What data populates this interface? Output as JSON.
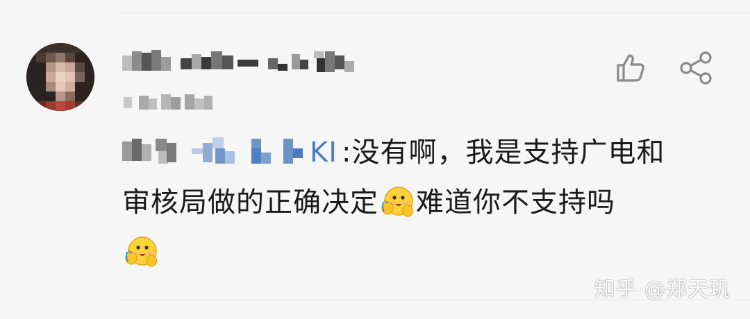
{
  "comment": {
    "author": "",
    "time": "",
    "mention_tail": "KI",
    "text_part1": ":没有啊，我是支持广电和",
    "text_part2": "审核局做的正确决定",
    "text_part3": "难道你不支持吗",
    "emoji": "hugging-emoji"
  },
  "actions": {
    "like_icon": "thumbs-up-icon",
    "share_icon": "share-icon"
  },
  "watermark": "知乎 @郑天玑",
  "colors": {
    "background": "#f6f6f6",
    "text": "#1a1a1a",
    "mention": "#4a7fc1",
    "icon": "#8a8a8a"
  }
}
